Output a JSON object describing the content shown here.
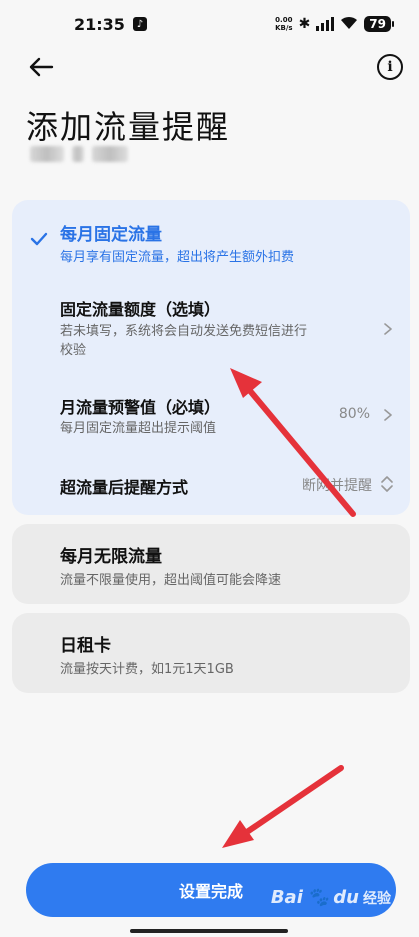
{
  "status_bar": {
    "time": "21:35",
    "net_speed_value": "0.00",
    "net_speed_unit": "KB/s",
    "battery": "79"
  },
  "header": {
    "title": "添加流量提醒"
  },
  "plans": {
    "fixed": {
      "title": "每月固定流量",
      "desc": "每月享有固定流量，超出将产生额外扣费",
      "rows": {
        "quota": {
          "title": "固定流量额度（选填）",
          "desc_line1": "若未填写，系统将会自动发送免费短信进行",
          "desc_line2": "校验"
        },
        "warning": {
          "title": "月流量预警值（必填）",
          "desc": "每月固定流量超出提示阈值",
          "value": "80%"
        },
        "method": {
          "title": "超流量后提醒方式",
          "value": "断网并提醒"
        }
      }
    },
    "unlimited": {
      "title": "每月无限流量",
      "desc": "流量不限量使用，超出阈值可能会降速"
    },
    "daily": {
      "title": "日租卡",
      "desc": "流量按天计费，如1元1天1GB"
    }
  },
  "footer": {
    "done_label": "设置完成"
  },
  "watermark": {
    "brand": "Bai",
    "brand_du": "du",
    "suffix": "经验"
  },
  "colors": {
    "accent": "#2f7bf0",
    "selected_card_bg": "#e7eefb",
    "card_bg": "#ebebeb",
    "annotation_arrow": "#e5323a"
  }
}
